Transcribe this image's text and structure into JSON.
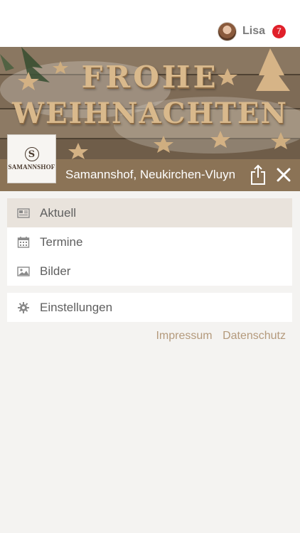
{
  "header": {
    "user_name": "Lisa",
    "notification_count": "7"
  },
  "banner": {
    "line1": "FROHE",
    "line2": "WEIHNACHTEN",
    "logo_text": "SAMANNSHOF",
    "logo_mark": "S"
  },
  "location": {
    "title": "Samannshof,  Neukirchen-Vluyn"
  },
  "menu": {
    "items": [
      {
        "label": "Aktuell",
        "icon": "newspaper-icon",
        "active": true
      },
      {
        "label": "Termine",
        "icon": "calendar-icon",
        "active": false
      },
      {
        "label": "Bilder",
        "icon": "image-icon",
        "active": false
      }
    ],
    "settings_label": "Einstellungen",
    "settings_icon": "gear-icon"
  },
  "footer": {
    "impressum": "Impressum",
    "datenschutz": "Datenschutz"
  },
  "colors": {
    "accent": "#8b7356",
    "active_row": "#e9e3dc",
    "badge": "#e0202a",
    "link": "#b49a7c"
  }
}
